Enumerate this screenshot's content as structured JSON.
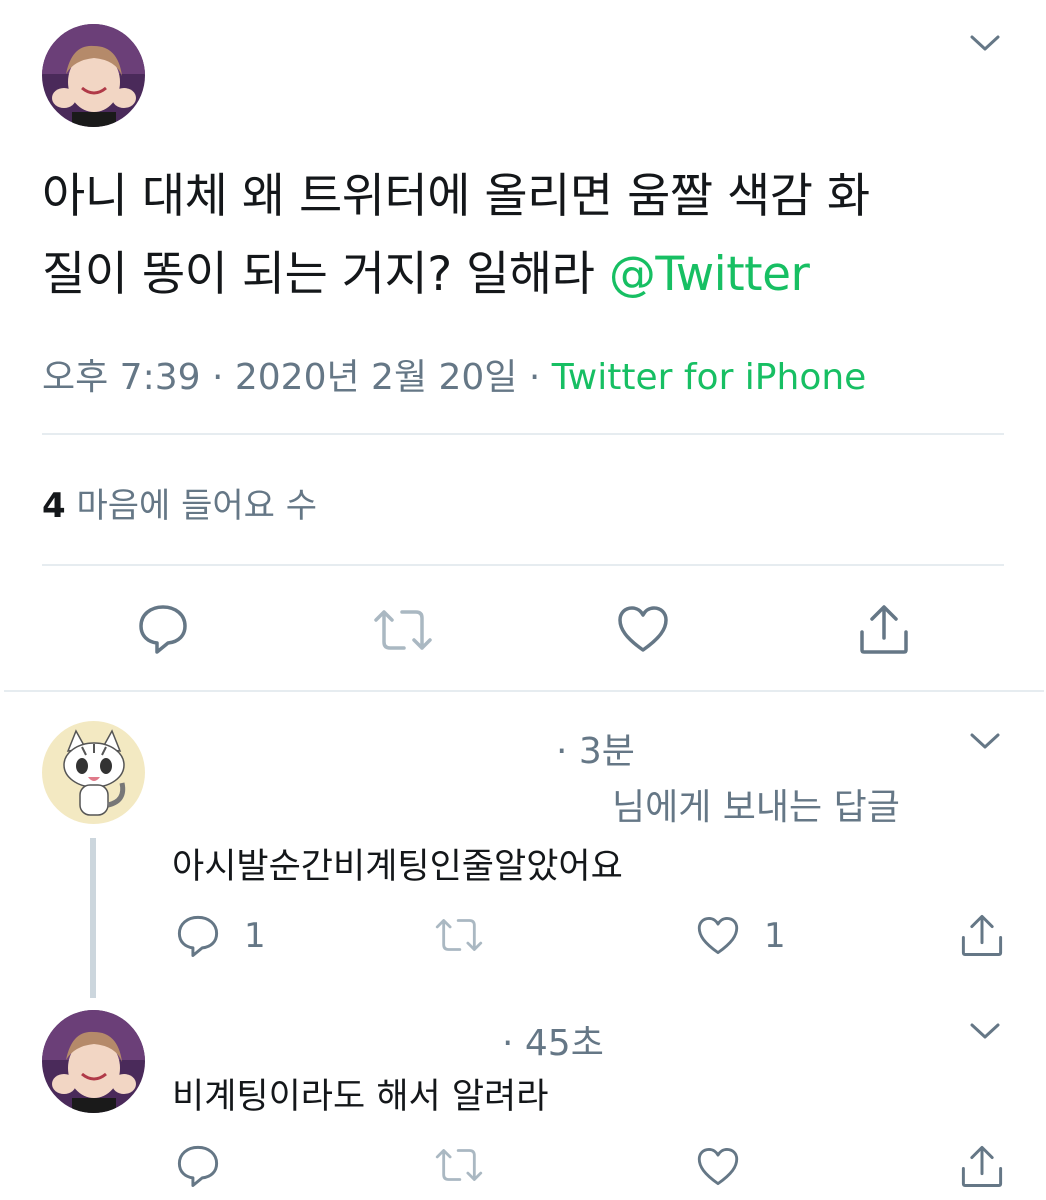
{
  "main_tweet": {
    "text_line1": "아니 대체 왜 트위터에 올리면 움짤 색감 화",
    "text_line2": "질이 똥이 되는 거지? 일해라",
    "mention": "@Twitter",
    "meta_time": "오후 7:39 · 2020년 2월 20일 · ",
    "meta_source": "Twitter for iPhone",
    "likes_count": "4",
    "likes_label": " 마음에 들어요 수"
  },
  "replies": [
    {
      "time": "· 3분",
      "replying_to": "님에게 보내는 답글",
      "text": "아시발순간비계팅인줄알았어요",
      "reply_count": "1",
      "like_count": "1"
    },
    {
      "time": "· 45초",
      "text": "비계팅이라도 해서 알려라"
    }
  ],
  "icons": {
    "reply": "reply-icon",
    "retweet": "retweet-icon",
    "like": "heart-icon",
    "share": "share-icon",
    "more": "chevron-down-icon"
  },
  "colors": {
    "accent_green": "#17bf63",
    "muted": "#657786",
    "icon_gray": "#657786",
    "icon_disabled": "#aab8c2",
    "divider": "#e6ecf0"
  }
}
